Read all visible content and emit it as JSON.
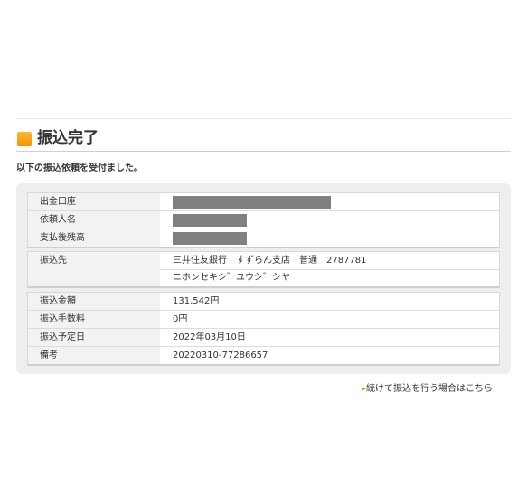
{
  "header": {
    "title": "振込完了",
    "subtitle": "以下の振込依頼を受付ました。"
  },
  "account_group": {
    "rows": [
      {
        "label": "出金口座",
        "value_redacted": true
      },
      {
        "label": "依頼人名",
        "value_redacted": true
      },
      {
        "label": "支払後残高",
        "value_redacted": true
      }
    ]
  },
  "recipient_group": {
    "label": "振込先",
    "line1": "三井住友銀行　すずらん支店　普通　2787781",
    "line2": "ニホンセキシ゛ユウシ゛シヤ"
  },
  "transfer_group": {
    "rows": [
      {
        "label": "振込金額",
        "value": "131,542円"
      },
      {
        "label": "振込手数料",
        "value": "0円"
      },
      {
        "label": "振込予定日",
        "value": "2022年03月10日"
      },
      {
        "label": "備考",
        "value": "20220310-77286657"
      }
    ]
  },
  "footer": {
    "link_arrow": "▸",
    "link_text": "続けて振込を行う場合はこちら"
  },
  "colors": {
    "accent": "#f39200",
    "panel_bg": "#eeeeee",
    "label_bg": "#f2f2f2",
    "redaction": "#808080"
  }
}
